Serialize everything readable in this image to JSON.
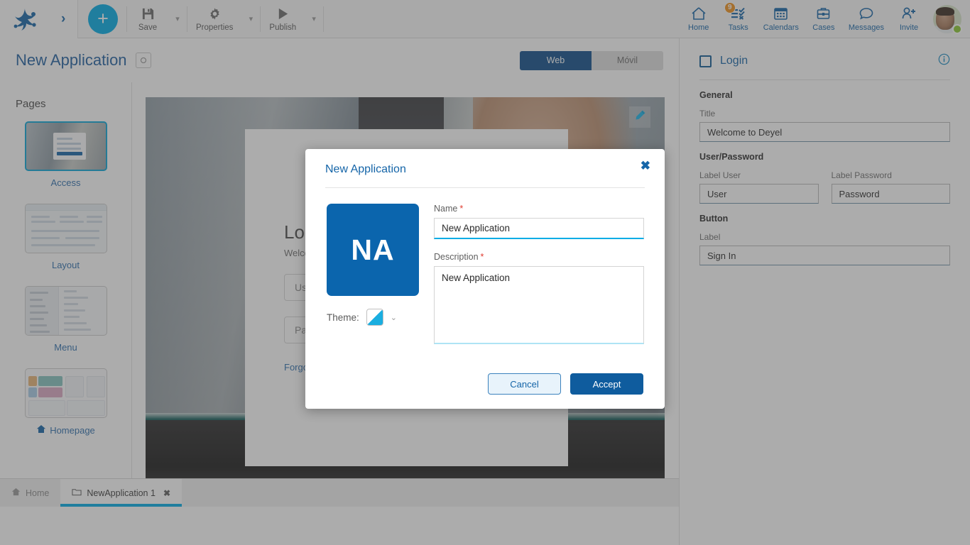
{
  "topbar": {
    "logo_icon": "deyel-logo-icon",
    "expand_icon": "chevron-right-icon",
    "add_label": "+",
    "tools": [
      {
        "label": "Save",
        "icon": "save-icon"
      },
      {
        "label": "Properties",
        "icon": "gear-icon"
      },
      {
        "label": "Publish",
        "icon": "play-icon"
      }
    ],
    "nav": [
      {
        "label": "Home",
        "icon": "home-icon",
        "badge": ""
      },
      {
        "label": "Tasks",
        "icon": "tasks-icon",
        "badge": "9"
      },
      {
        "label": "Calendars",
        "icon": "calendar-icon",
        "badge": ""
      },
      {
        "label": "Cases",
        "icon": "briefcase-icon",
        "badge": ""
      },
      {
        "label": "Messages",
        "icon": "message-icon",
        "badge": ""
      },
      {
        "label": "Invite",
        "icon": "invite-user-icon",
        "badge": ""
      }
    ],
    "avatar_status": "online"
  },
  "page": {
    "title": "New Application",
    "view_toggle": {
      "web": "Web",
      "mobile": "Móvil",
      "selected": "Web"
    }
  },
  "pages_panel": {
    "heading": "Pages",
    "items": [
      {
        "label": "Access",
        "selected": true,
        "icon": ""
      },
      {
        "label": "Layout",
        "selected": false,
        "icon": ""
      },
      {
        "label": "Menu",
        "selected": false,
        "icon": ""
      },
      {
        "label": "Homepage",
        "selected": false,
        "icon": "home-icon"
      }
    ]
  },
  "canvas": {
    "edit_icon": "pencil-icon",
    "login_preview": {
      "heading": "Login",
      "subtitle": "Welcome to Deyel",
      "user_placeholder": "User",
      "password_placeholder": "Password",
      "forgot_link": "Forgot your password?"
    }
  },
  "properties": {
    "header_title": "Login",
    "checkbox_icon": "checkbox-icon",
    "info_icon": "info-icon",
    "sections": [
      {
        "title": "General",
        "fields": [
          {
            "label": "Title",
            "value": "Welcome to Deyel"
          }
        ]
      },
      {
        "title": "User/Password",
        "fields": [
          {
            "label": "Label User",
            "value": "User"
          },
          {
            "label": "Label Password",
            "value": "Password"
          }
        ]
      },
      {
        "title": "Button",
        "fields": [
          {
            "label": "Label",
            "value": "Sign In"
          }
        ]
      }
    ]
  },
  "tabbar": {
    "tabs": [
      {
        "label": "Home",
        "icon": "home-icon",
        "active": false,
        "closable": false
      },
      {
        "label": "NewApplication 1",
        "icon": "folder-icon",
        "active": true,
        "closable": true,
        "close_glyph": "✖"
      }
    ]
  },
  "modal": {
    "title": "New Application",
    "close_glyph": "✖",
    "tile_initials": "NA",
    "theme_label": "Theme:",
    "theme_caret": "⌄",
    "name_label": "Name",
    "name_required": "*",
    "name_value": "New Application",
    "description_label": "Description",
    "description_required": "*",
    "description_value": "New Application",
    "cancel_label": "Cancel",
    "accept_label": "Accept"
  },
  "colors": {
    "brand_blue": "#1565a8",
    "accent_cyan": "#00ace6",
    "tile_blue": "#0b65ad",
    "badge_orange": "#f0921e",
    "required_red": "#e03b2f",
    "status_green": "#8bc832"
  }
}
